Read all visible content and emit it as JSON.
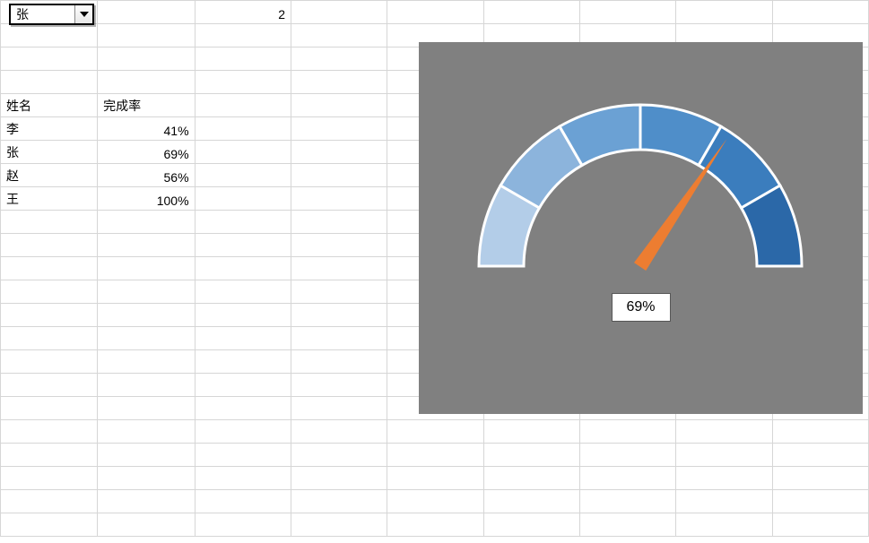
{
  "dropdown": {
    "selected": "张",
    "options": [
      "李",
      "张",
      "赵",
      "王"
    ]
  },
  "cell_c1": "2",
  "table": {
    "headers": {
      "name": "姓名",
      "rate": "完成率"
    },
    "rows": [
      {
        "name": "李",
        "rate": "41%"
      },
      {
        "name": "张",
        "rate": "69%"
      },
      {
        "name": "赵",
        "rate": "56%"
      },
      {
        "name": "王",
        "rate": "100%"
      }
    ]
  },
  "gauge": {
    "value_pct": 69,
    "display_text": "69%",
    "segment_colors": [
      "#b3cde8",
      "#8cb4dc",
      "#6ba1d4",
      "#4f8ec9",
      "#3b7dbd",
      "#2b68a8"
    ],
    "needle_color": "#ed7d31",
    "bg": "#808080"
  },
  "chart_data": {
    "type": "bar",
    "title": "",
    "xlabel": "姓名",
    "ylabel": "完成率",
    "categories": [
      "李",
      "张",
      "赵",
      "王"
    ],
    "values": [
      41,
      69,
      56,
      100
    ],
    "ylim": [
      0,
      100
    ],
    "gauge": {
      "value": 69,
      "min": 0,
      "max": 100,
      "segments": 6
    }
  }
}
